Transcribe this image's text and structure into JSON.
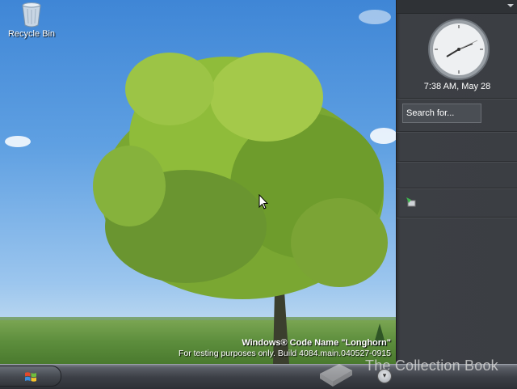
{
  "desktop": {
    "icons": [
      {
        "label": "Recycle Bin",
        "icon": "recycle-bin-icon"
      }
    ],
    "watermark": {
      "title": "Windows® Code Name \"Longhorn\"",
      "subtitle": "For testing purposes only. Build 4084.main.040527-0915"
    }
  },
  "sidebar": {
    "clock": {
      "time": "7:38 AM, May 28"
    },
    "search": {
      "placeholder": "Search for..."
    },
    "tile_icon": "slideshow-icon"
  },
  "taskbar": {
    "start_icon": "windows-flag-icon",
    "quick_launch_icon": "chevron-down-icon"
  },
  "overlay": {
    "text": "The Collection Book"
  },
  "colors": {
    "sidebar_bg": "#3b3e43",
    "taskbar_bg": "#3d4047"
  }
}
